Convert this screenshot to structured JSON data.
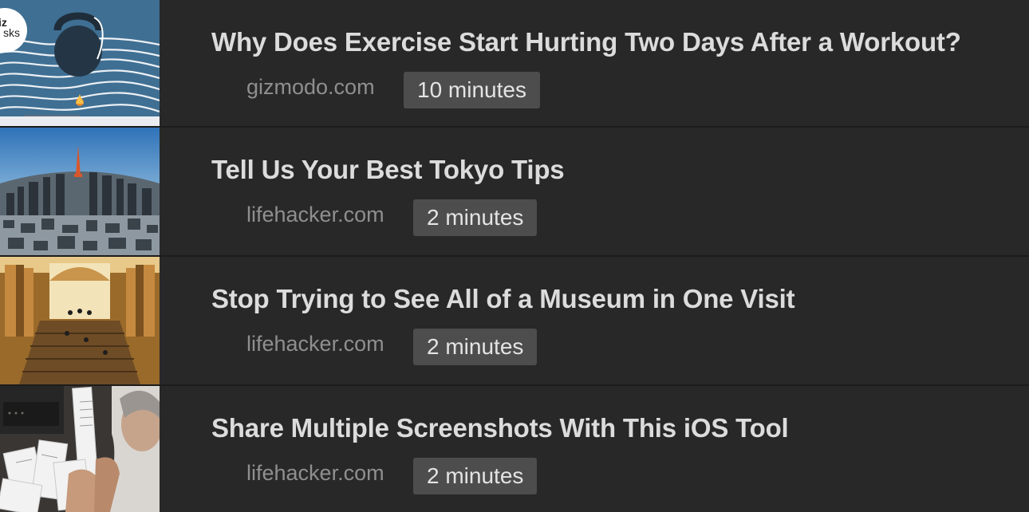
{
  "articles": [
    {
      "title": "Why Does Exercise Start Hurting Two Days After a Workout?",
      "source": "gizmodo.com",
      "read_time": "10 minutes",
      "thumbnail": {
        "badge_line1": "iz",
        "badge_line2": "sks",
        "icon": "kettlebell-icon"
      }
    },
    {
      "title": "Tell Us Your Best Tokyo Tips",
      "source": "lifehacker.com",
      "read_time": "2 minutes",
      "thumbnail": {
        "icon": "city-skyline-icon"
      }
    },
    {
      "title": "Stop Trying to See All of a Museum in One Visit",
      "source": "lifehacker.com",
      "read_time": "2 minutes",
      "thumbnail": {
        "icon": "museum-hall-icon"
      }
    },
    {
      "title": "Share Multiple Screenshots With This iOS Tool",
      "source": "lifehacker.com",
      "read_time": "2 minutes",
      "thumbnail": {
        "icon": "receipts-photo-icon"
      }
    }
  ],
  "colors": {
    "background": "#282828",
    "title": "#dcdcdc",
    "source": "#8f8f8f",
    "badge_bg": "#4d4d4d",
    "badge_text": "#e4e4e4"
  }
}
